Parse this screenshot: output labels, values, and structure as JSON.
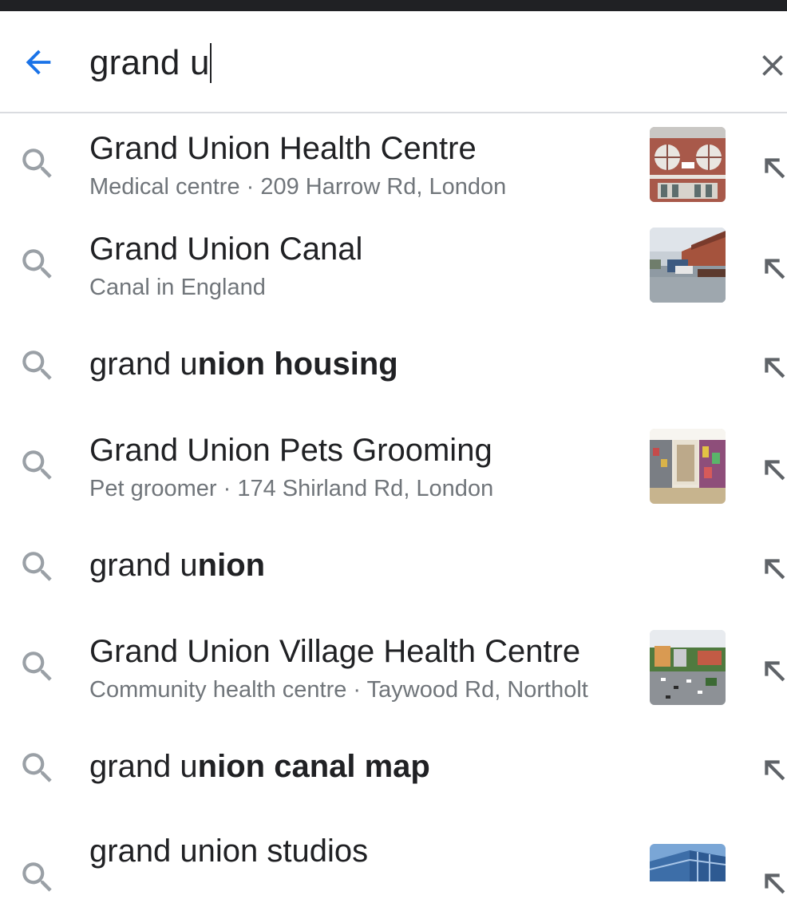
{
  "search": {
    "query": "grand u"
  },
  "suggestions": [
    {
      "title": "Grand Union Health Centre",
      "bold": "",
      "subtitle": "Medical centre · 209 Harrow Rd, London",
      "thumbnail": "building-health-centre"
    },
    {
      "title": "Grand Union Canal",
      "bold": "",
      "subtitle": "Canal in England",
      "thumbnail": "canal-boats"
    },
    {
      "title": "grand u",
      "bold": "nion housing",
      "subtitle": "",
      "thumbnail": ""
    },
    {
      "title": "Grand Union Pets Grooming",
      "bold": "",
      "subtitle": "Pet groomer · 174 Shirland Rd, London",
      "thumbnail": "pet-shop-interior"
    },
    {
      "title": "grand u",
      "bold": "nion",
      "subtitle": "",
      "thumbnail": ""
    },
    {
      "title": "Grand Union Village Health Centre",
      "bold": "",
      "subtitle": "Community health centre · Taywood Rd, Northolt",
      "thumbnail": "aerial-village"
    },
    {
      "title": "grand u",
      "bold": "nion canal map",
      "subtitle": "",
      "thumbnail": ""
    },
    {
      "title": "grand union studios",
      "bold": "",
      "subtitle": "",
      "thumbnail": "office-building"
    }
  ],
  "icons": {
    "back": "arrow-left-icon",
    "clear": "close-icon",
    "search": "search-icon",
    "fill": "arrow-up-left-icon"
  },
  "colors": {
    "accent": "#1a73e8",
    "text_primary": "#202124",
    "text_secondary": "#70757a",
    "icon_gray": "#9aa0a6",
    "status_bar": "#202124"
  }
}
